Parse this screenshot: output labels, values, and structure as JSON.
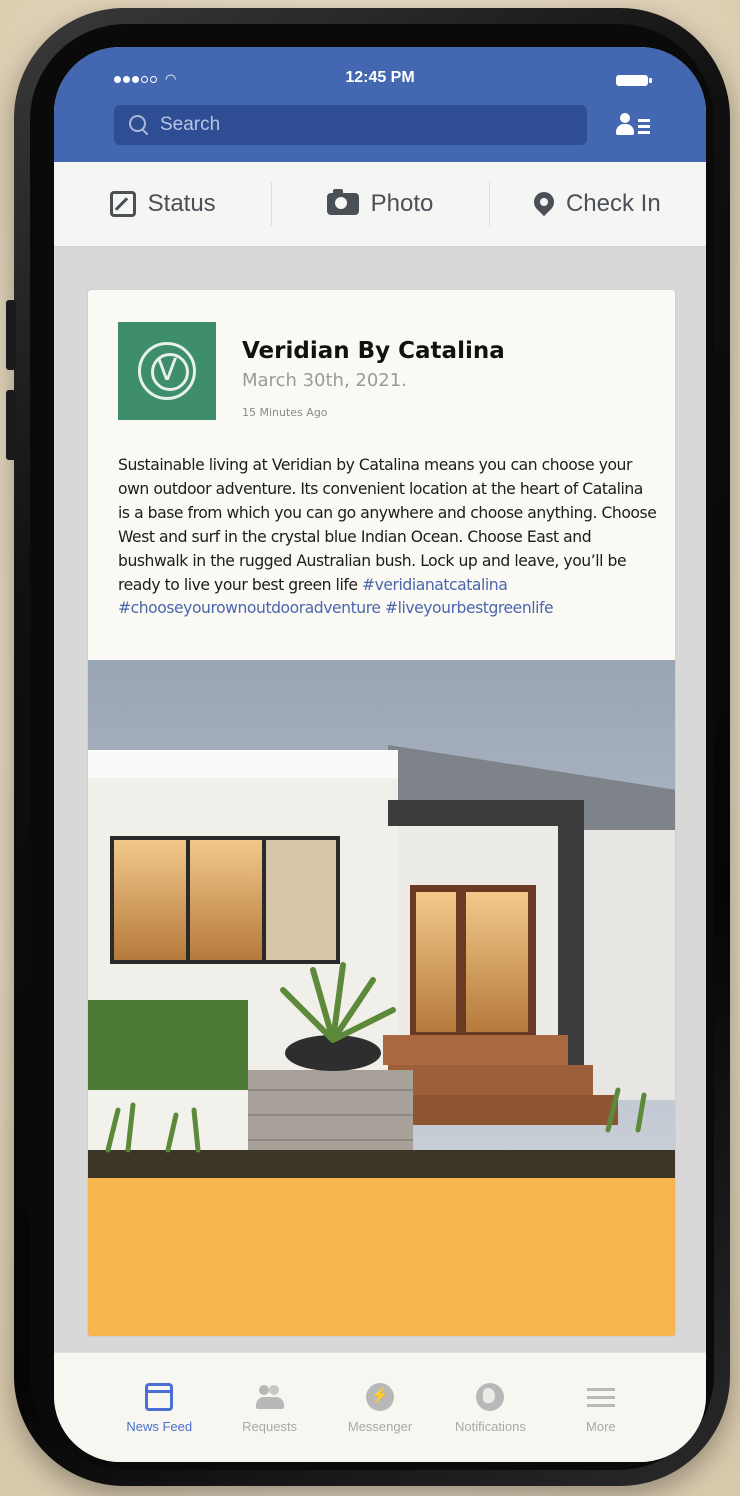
{
  "status_bar": {
    "time": "12:45 PM"
  },
  "header": {
    "search": {
      "placeholder": "Search"
    }
  },
  "composer": {
    "status_label": "Status",
    "photo_label": "Photo",
    "checkin_label": "Check In"
  },
  "post": {
    "page_name": "Veridian By Catalina",
    "date": "March 30th, 2021.",
    "time_ago": "15 Minutes Ago",
    "body": "Sustainable living at Veridian by Catalina means you can choose your own outdoor adventure.  Its convenient location at the heart of Catalina is a base from which you can go anywhere and choose anything.  Choose West and surf in the crystal blue Indian Ocean. Choose East and bushwalk in the rugged Australian bush.  Lock up and leave, you’ll be ready to live your best green life ",
    "hashtags": "#veridianatcatalina #chooseyourownoutdooradventure #liveyourbestgreenlife",
    "avatar_color": "#3f8e6b"
  },
  "tabbar": {
    "items": [
      {
        "label": "News Feed",
        "icon": "news-feed-icon",
        "active": true
      },
      {
        "label": "Requests",
        "icon": "friend-requests-icon",
        "active": false
      },
      {
        "label": "Messenger",
        "icon": "messenger-icon",
        "active": false
      },
      {
        "label": "Notifications",
        "icon": "globe-icon",
        "active": false
      },
      {
        "label": "More",
        "icon": "hamburger-menu-icon",
        "active": false
      }
    ]
  },
  "colors": {
    "brand_blue": "#4467b2",
    "active_tab": "#4a6fd0",
    "hashtag": "#4a67ad",
    "accent_orange": "#f6b54f"
  }
}
